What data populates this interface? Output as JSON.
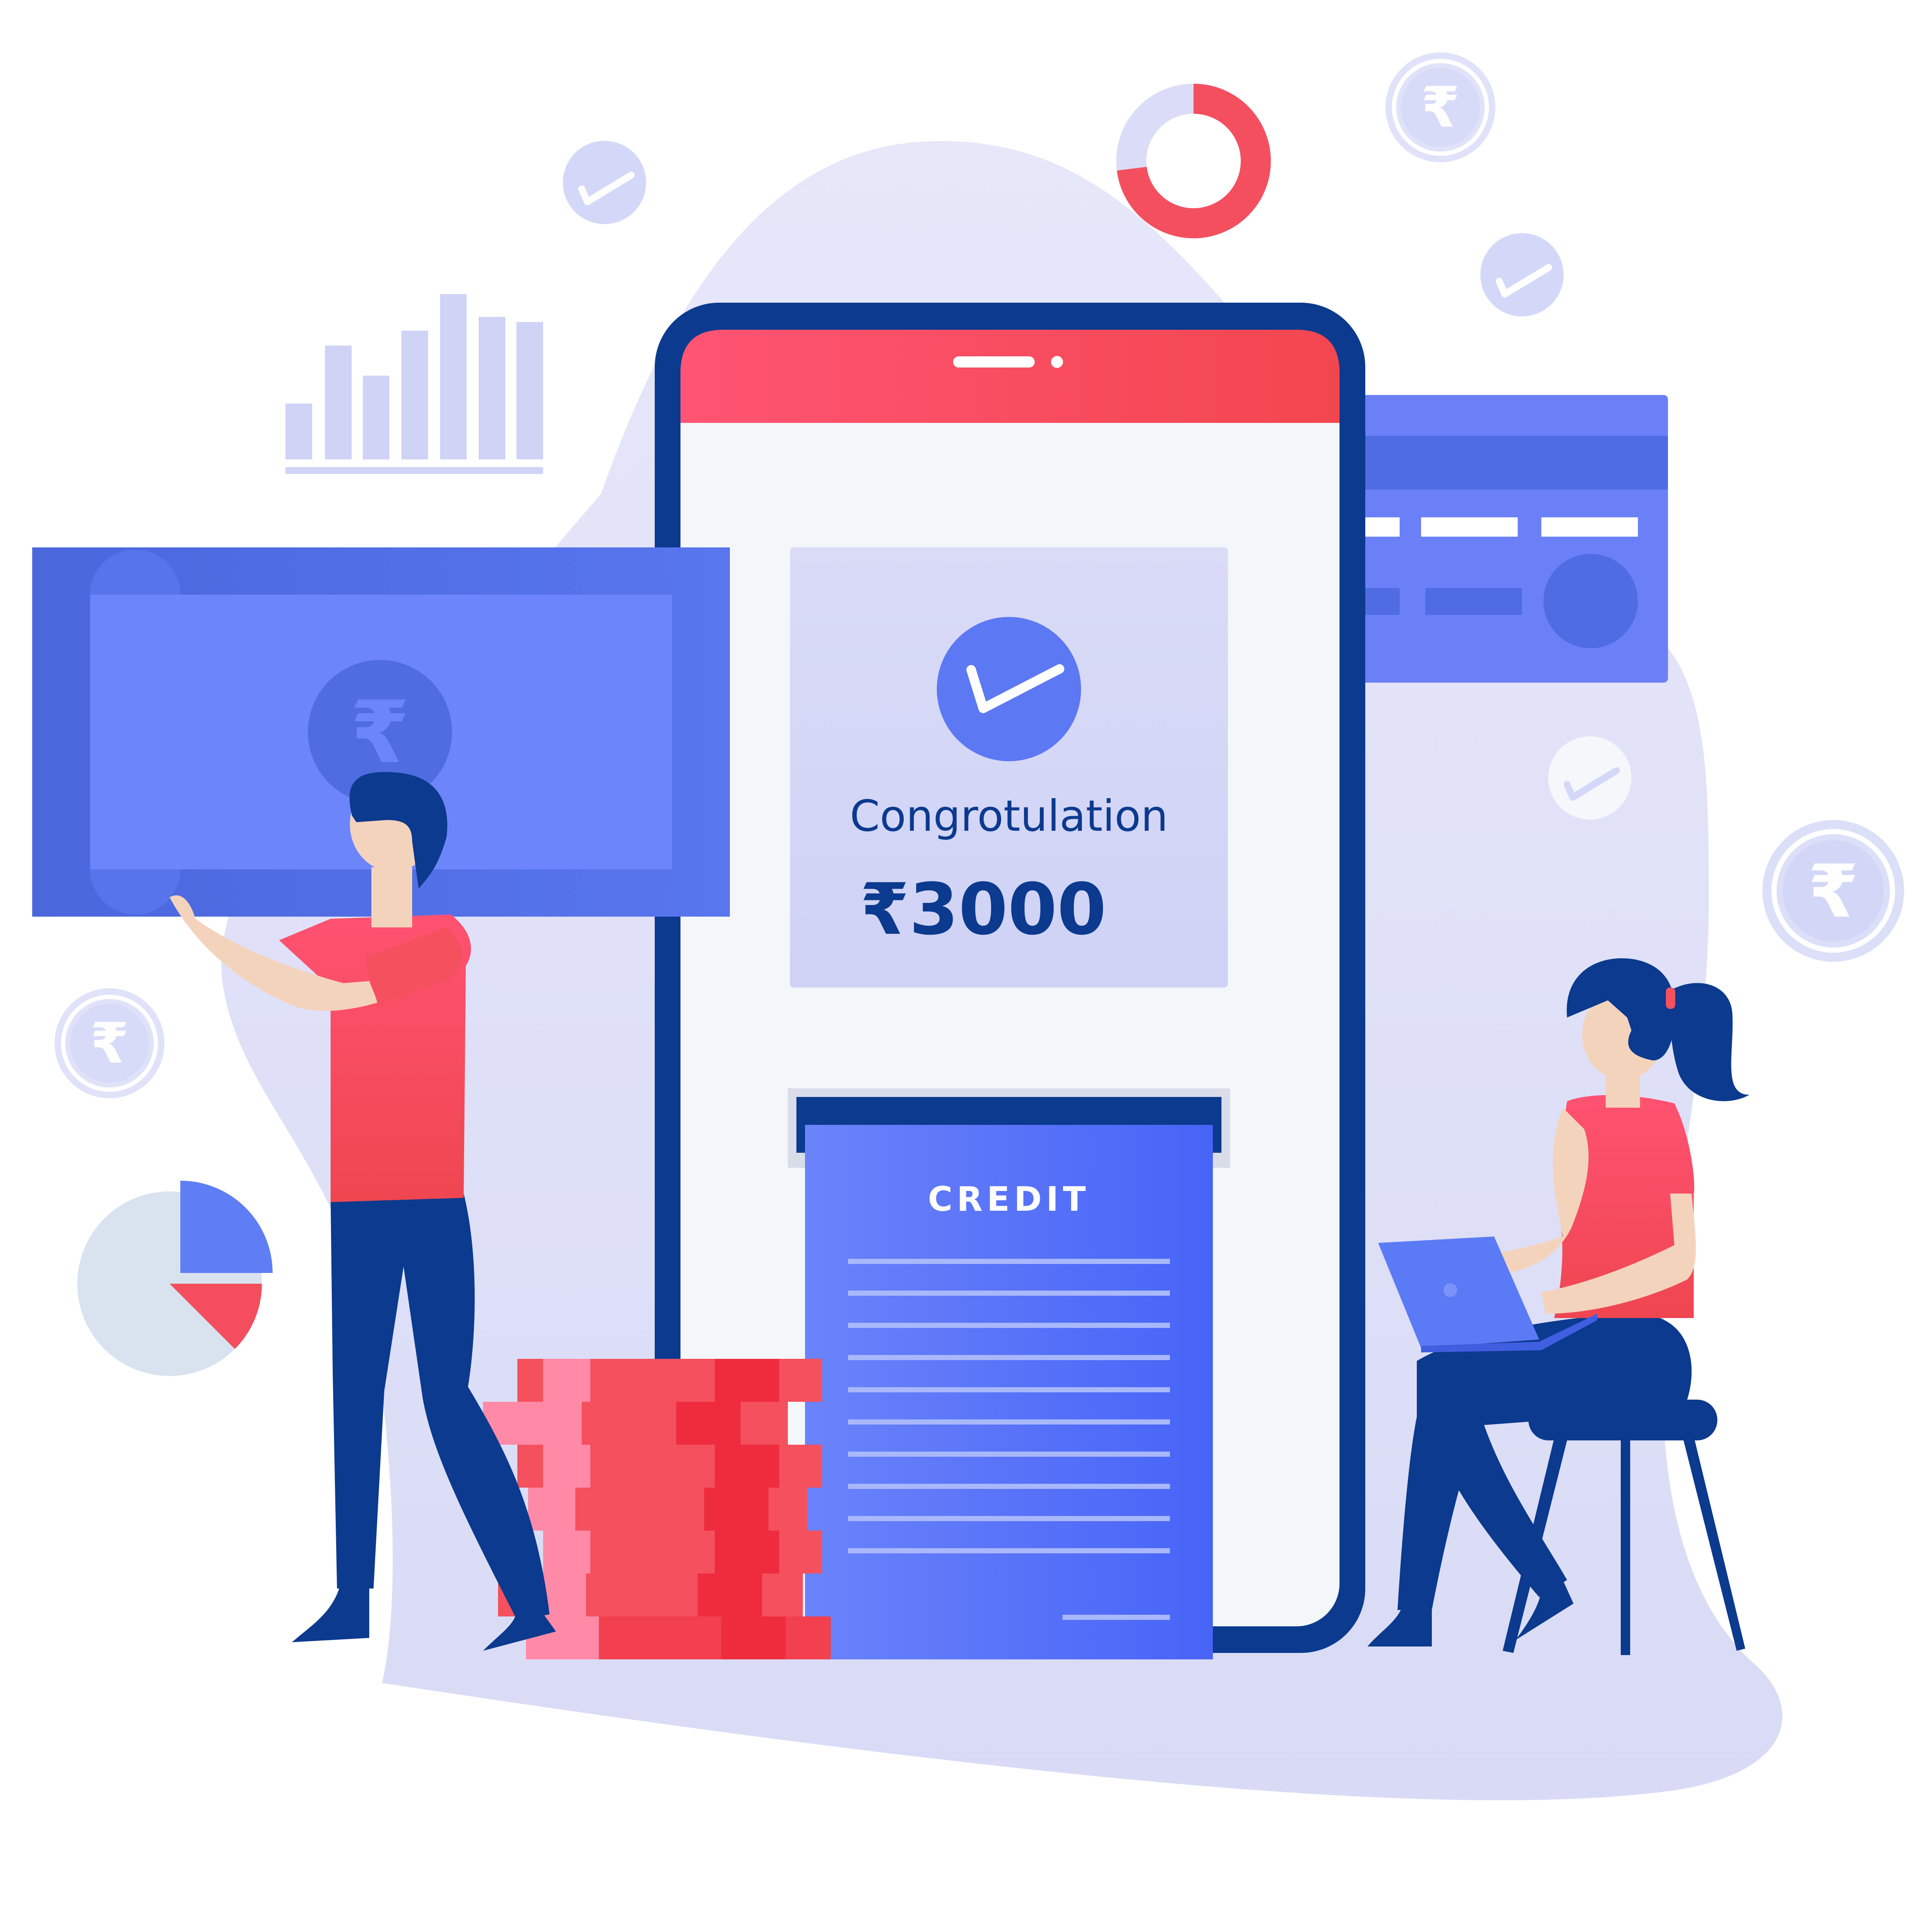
{
  "phone_screen": {
    "congrats_text": "Congrotulation",
    "amount_text": "₹3000"
  },
  "credit_document": {
    "title": "CREDIT"
  },
  "coin_symbol": "₹",
  "icons": {
    "check": "check-circle-icon",
    "rupee": "rupee-coin-icon",
    "bar_chart": "bar-chart-icon",
    "donut_chart": "donut-chart-icon",
    "pie_chart": "pie-chart-icon",
    "credit_card": "credit-card-icon",
    "banknote": "banknote-icon"
  },
  "colors": {
    "primary_blue": "#5b7af5",
    "dark_navy": "#0b3a8e",
    "accent_red": "#f4505e",
    "lavender_bg": "#e2e4f8",
    "skin": "#f4d3bd"
  }
}
